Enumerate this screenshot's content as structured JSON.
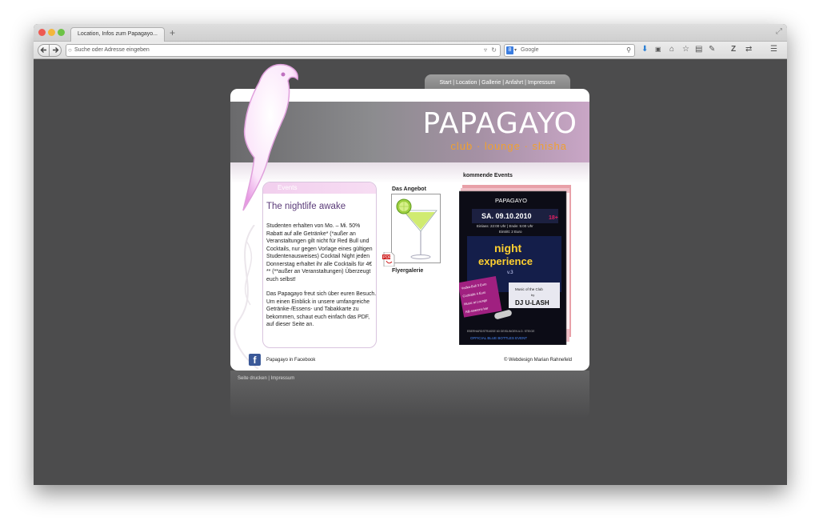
{
  "browser": {
    "tab_title": "Location, Infos zum Papagayo...",
    "new_tab": "+",
    "url_placeholder": "Suche oder Adresse eingeben",
    "search_placeholder": "Google",
    "search_engine": "8"
  },
  "site": {
    "menu": "Start | Location | Gallerie | Anfahrt | Impressum",
    "brand": "PAPAGAYO",
    "tagline": "club · lounge · shisha",
    "events_head": "Events",
    "events_title": "The nightlife awake",
    "events_p1": "Studenten erhalten von Mo. – Mi. 50% Rabatt auf alle Getränke* (*außer an Veranstaltungen gilt nicht für Red Bull und Cocktails, nur gegen Vorlage eines gültigen Studentenausweises) Cocktail Night jeden Donnerstag erhaltet ihr alle Cocktails für 4€ ** (**außer an Veranstaltungen) Überzeugt euch selbst!",
    "events_p2": "Das Papagayo freut sich über euren Besuch. Um einen Einblick in unsere umfangreiche Getränke-/Essens- und Tabakkarte zu bekommen, schaut euch einfach das PDF, auf dieser Seite an.",
    "angebot_label": "Das Angebot",
    "flyer_label": "Flyergalerie",
    "kommende_label": "kommende Events",
    "flyer": {
      "brand": "PAPAGAYO",
      "date": "SA. 09.10.2010",
      "age": "18+",
      "times": "Einlass: 22:00 Uhr | Ende: 5:00 Uhr",
      "entry": "Eintritt: 2 Euro",
      "title_1": "night",
      "title_2": "experience",
      "version": "v.3",
      "promo_1": "Vodka-Bull 3 Euro",
      "promo_2": "Cocktails 4 Euro",
      "promo_3": "Music at Lounge",
      "promo_4": "RB-seasons bar",
      "music_of": "Music of the Club",
      "by": "by",
      "dj": "DJ U-LASH",
      "address": "EBERHARDSTRASSE 60 GEISLINGEN A.D. STEIGE",
      "event": "OFFICIAL BLUE BOTTLES EVENT"
    },
    "pdf_icon_label": "PDF",
    "facebook_icon": "f",
    "facebook_text": "Papagayo in Facebook",
    "credit": "© Webdesign Marian Rahnefeld",
    "below_links": "Seite drucken | Impressum"
  }
}
